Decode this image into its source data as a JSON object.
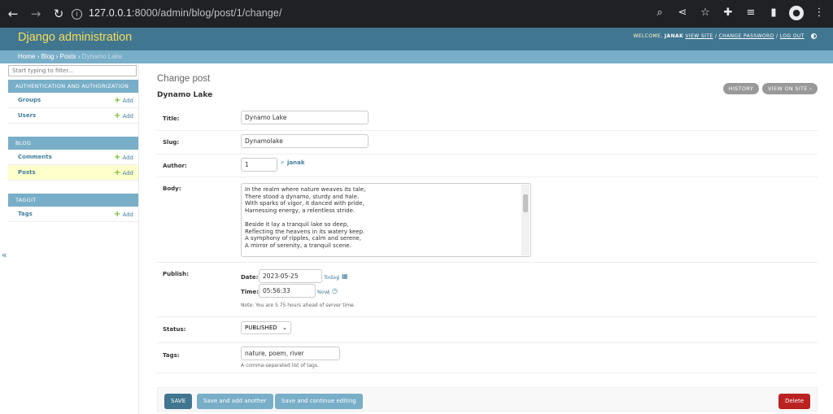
{
  "browser": {
    "url_host": "127.0.0.1",
    "url_rest": ":8000/admin/blog/post/1/change/"
  },
  "header": {
    "brand": "Django administration",
    "welcome": "WELCOME,",
    "user": "JANAK",
    "view_site": "VIEW SITE",
    "change_password": "CHANGE PASSWORD",
    "log_out": "LOG OUT",
    "sep": "/"
  },
  "breadcrumbs": {
    "home": "Home",
    "app": "Blog",
    "model": "Posts",
    "current": "Dynamo Lake",
    "sep": "›"
  },
  "sidebar": {
    "filter_placeholder": "Start typing to filter...",
    "add_label": "Add",
    "collapse": "«",
    "modules": [
      {
        "caption": "AUTHENTICATION AND AUTHORIZATION",
        "models": [
          "Groups",
          "Users"
        ]
      },
      {
        "caption": "BLOG",
        "models": [
          "Comments",
          "Posts"
        ]
      },
      {
        "caption": "TAGGIT",
        "models": [
          "Tags"
        ]
      }
    ]
  },
  "main": {
    "page_title": "Change post",
    "object_title": "Dynamo Lake",
    "history": "HISTORY",
    "view_on_site": "VIEW ON SITE",
    "fields": {
      "title_label": "Title:",
      "title_value": "Dynamo Lake",
      "slug_label": "Slug:",
      "slug_value": "Dynamolake",
      "author_label": "Author:",
      "author_value": "1",
      "author_name": "janak",
      "body_label": "Body:",
      "body_lines": [
        "In the realm where nature weaves its tale,",
        "There stood a dynamo, sturdy and hale.",
        "With sparks of vigor, it danced with pride,",
        "Harnessing energy, a relentless stride.",
        "",
        "Beside it lay a tranquil lake so deep,",
        "Reflecting the heavens in its watery keep.",
        "A symphony of ripples, calm and serene,",
        "A mirror of serenity, a tranquil scene.",
        ""
      ],
      "publish_label": "Publish:",
      "date_label": "Date:",
      "date_value": "2023-05-25",
      "today": "Today",
      "time_label": "Time:",
      "time_value": "05:56:33",
      "now": "Now",
      "pipe": "|",
      "tz_note": "Note: You are 5.75 hours ahead of server time.",
      "status_label": "Status:",
      "status_value": "PUBLISHED",
      "tags_label": "Tags:",
      "tags_value": "nature, poem, river",
      "tags_help": "A comma-separated list of tags."
    },
    "buttons": {
      "save": "SAVE",
      "save_add": "Save and add another",
      "save_continue": "Save and continue editing",
      "delete": "Delete"
    }
  }
}
